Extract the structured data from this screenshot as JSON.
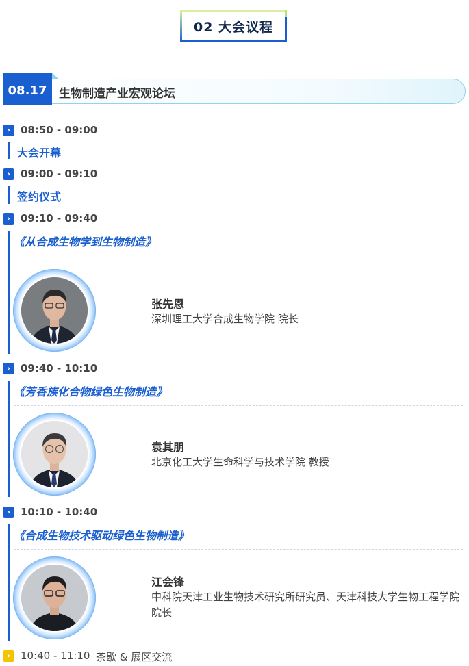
{
  "section": {
    "title": "02 大会议程"
  },
  "session": {
    "date": "08.17",
    "title": "生物制造产业宏观论坛"
  },
  "agenda": [
    {
      "time": "08:50 - 09:00",
      "activity": "大会开幕"
    },
    {
      "time": "09:00 - 09:10",
      "activity": "签约仪式"
    },
    {
      "time": "09:10 - 09:40",
      "talk": "《从合成生物学到生物制造》",
      "speaker": {
        "name": "张先恩",
        "title": "深圳理工大学合成生物学院 院长"
      }
    },
    {
      "time": "09:40 - 10:10",
      "talk": "《芳香族化合物绿色生物制造》",
      "speaker": {
        "name": "袁其朋",
        "title": "北京化工大学生命科学与技术学院 教授"
      }
    },
    {
      "time": "10:10 - 10:40",
      "talk": "《合成生物技术驱动绿色生物制造》",
      "speaker": {
        "name": "江会锋",
        "title": "中科院天津工业生物技术研究所研究员、天津科技大学生物工程学院 院长"
      }
    },
    {
      "time": "10:40 - 11:10",
      "activity": "茶歇 & 展区交流"
    }
  ],
  "colors": {
    "accent": "#1a5fd0",
    "break_icon": "#f5c400",
    "text": "#333333"
  },
  "icons": {
    "time_marker": "chevron-right-icon"
  }
}
